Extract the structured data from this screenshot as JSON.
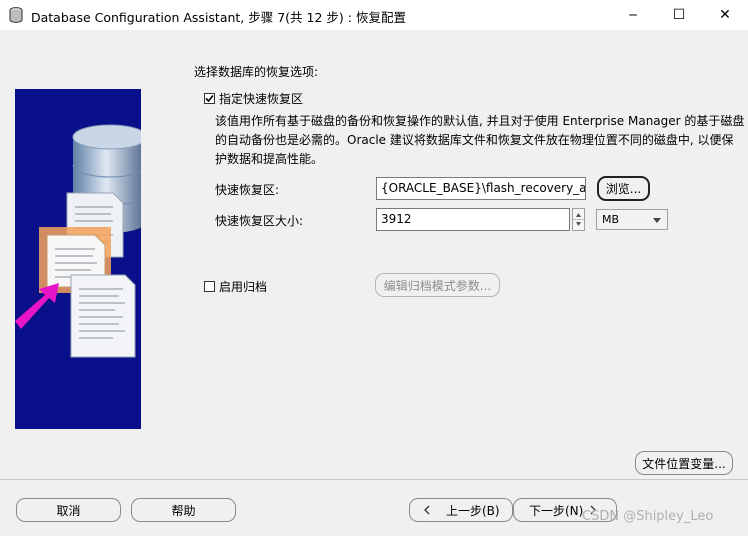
{
  "window": {
    "title": "Database Configuration Assistant, 步骤 7(共 12 步) : 恢复配置",
    "controls": {
      "minimize": "─",
      "maximize": "☐",
      "close": "✕"
    }
  },
  "recovery": {
    "heading": "选择数据库的恢复选项:",
    "fra_checkbox": {
      "checked": true,
      "label": "指定快速恢复区"
    },
    "description_lines": [
      "该值用作所有基于磁盘的备份和恢复操作的默认值, 并且对于使用 Enterprise Manager 的基于磁盘",
      "的自动备份也是必需的。Oracle 建议将数据库文件和恢复文件放在物理位置不同的磁盘中, 以便保",
      "护数据和提高性能。"
    ],
    "fra_location": {
      "label": "快速恢复区:",
      "value": "{ORACLE_BASE}\\flash_recovery_area"
    },
    "browse_button": "浏览...",
    "fra_size": {
      "label": "快速恢复区大小:",
      "value": "3912"
    },
    "size_unit": {
      "selected": "MB"
    },
    "archive_checkbox": {
      "checked": false,
      "label": "启用归档"
    },
    "edit_archive_button": "编辑归档模式参数..."
  },
  "file_location_button": "文件位置变量...",
  "footer": {
    "cancel": "取消",
    "help": "帮助",
    "back": "上一步(B)",
    "next": "下一步(N)"
  },
  "watermark": "CSDN @Shipley_Leo",
  "colors": {
    "side_image_bg": "#0a0f8a",
    "arrow": "#e815c8"
  }
}
